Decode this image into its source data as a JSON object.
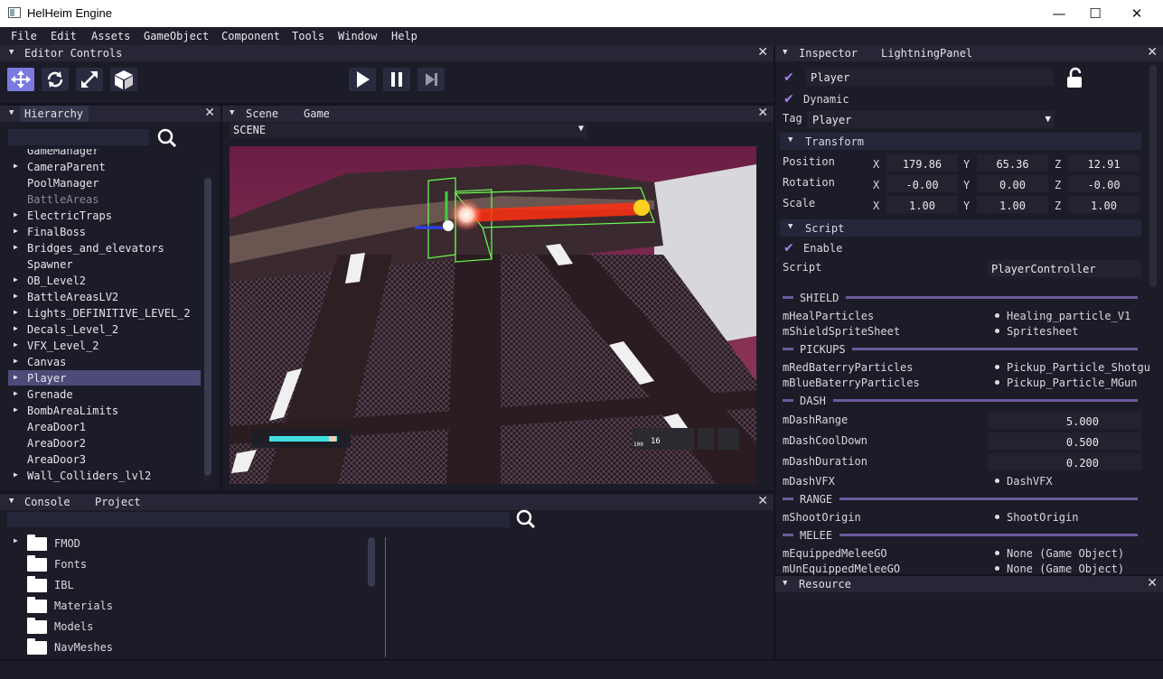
{
  "window": {
    "title": "HelHeim Engine",
    "minimize": "—",
    "maximize": "☐",
    "close": "✕"
  },
  "menu": [
    "File",
    "Edit",
    "Assets",
    "GameObject",
    "Component",
    "Tools",
    "Window",
    "Help"
  ],
  "editor_controls": {
    "title": "Editor Controls",
    "close": "✕"
  },
  "hierarchy": {
    "title": "Hierarchy",
    "close": "✕",
    "items": [
      {
        "label": "GameManager",
        "arrow": "",
        "dim": false
      },
      {
        "label": "CameraParent",
        "arrow": "▶",
        "dim": false
      },
      {
        "label": "PoolManager",
        "arrow": "",
        "dim": false
      },
      {
        "label": "BattleAreas",
        "arrow": "",
        "dim": true
      },
      {
        "label": "ElectricTraps",
        "arrow": "▶",
        "dim": false
      },
      {
        "label": "FinalBoss",
        "arrow": "▶",
        "dim": false
      },
      {
        "label": "Bridges_and_elevators",
        "arrow": "▶",
        "dim": false
      },
      {
        "label": "Spawner",
        "arrow": "",
        "dim": false
      },
      {
        "label": "OB_Level2",
        "arrow": "▶",
        "dim": false
      },
      {
        "label": "BattleAreasLV2",
        "arrow": "▶",
        "dim": false
      },
      {
        "label": "Lights_DEFINITIVE_LEVEL_2",
        "arrow": "▶",
        "dim": false
      },
      {
        "label": "Decals_Level_2",
        "arrow": "▶",
        "dim": false
      },
      {
        "label": "VFX_Level_2",
        "arrow": "▶",
        "dim": false
      },
      {
        "label": "Canvas",
        "arrow": "▶",
        "dim": false
      },
      {
        "label": "Player",
        "arrow": "▶",
        "dim": false,
        "selected": true
      },
      {
        "label": "Grenade",
        "arrow": "▶",
        "dim": false
      },
      {
        "label": "BombAreaLimits",
        "arrow": "▶",
        "dim": false
      },
      {
        "label": "AreaDoor1",
        "arrow": "",
        "dim": false
      },
      {
        "label": "AreaDoor2",
        "arrow": "",
        "dim": false
      },
      {
        "label": "AreaDoor3",
        "arrow": "",
        "dim": false
      },
      {
        "label": "Wall_Colliders_lvl2",
        "arrow": "▶",
        "dim": false
      }
    ]
  },
  "scene": {
    "tabs": [
      "Scene",
      "Game"
    ],
    "dropdown": "SCENE",
    "close": "✕",
    "hud_ammo": "16",
    "hud_charge": "100"
  },
  "console": {
    "tabs": [
      "Console",
      "Project"
    ],
    "close": "✕",
    "folders": [
      {
        "label": "FMOD",
        "arrow": "▶"
      },
      {
        "label": "Fonts",
        "arrow": ""
      },
      {
        "label": "IBL",
        "arrow": ""
      },
      {
        "label": "Materials",
        "arrow": ""
      },
      {
        "label": "Models",
        "arrow": ""
      },
      {
        "label": "NavMeshes",
        "arrow": ""
      }
    ]
  },
  "inspector": {
    "tabs": [
      "Inspector",
      "LightningPanel"
    ],
    "close": "✕",
    "name": "Player",
    "dynamic": "Dynamic",
    "tag_label": "Tag",
    "tag_value": "Player",
    "transform": {
      "title": "Transform",
      "rows": [
        {
          "label": "Position",
          "x": "179.86",
          "y": "65.36",
          "z": "12.91"
        },
        {
          "label": "Rotation",
          "x": "-0.00",
          "y": "0.00",
          "z": "-0.00"
        },
        {
          "label": "Scale",
          "x": "1.00",
          "y": "1.00",
          "z": "1.00"
        }
      ],
      "axes": [
        "X",
        "Y",
        "Z"
      ]
    },
    "script": {
      "title": "Script",
      "enable": "Enable",
      "label": "Script",
      "value": "PlayerController"
    },
    "groups": [
      {
        "name": "SHIELD"
      },
      {
        "name": "PICKUPS"
      },
      {
        "name": "DASH"
      },
      {
        "name": "RANGE"
      },
      {
        "name": "MELEE"
      }
    ],
    "refs": {
      "mHealParticles": "Healing_particle_V1",
      "mShieldSpriteSheet": "Spritesheet",
      "mRedBaterryParticles": "Pickup_Particle_Shotgu",
      "mBlueBaterryParticles": "Pickup_Particle_MGun",
      "mDashVFX": "DashVFX",
      "mShootOrigin": "ShootOrigin",
      "mEquippedMeleeGO": "None (Game Object)",
      "mUnEquippedMeleeGO": "None (Game Object)"
    },
    "nums": {
      "mDashRange": "5.000",
      "mDashCoolDown": "0.500",
      "mDashDuration": "0.200"
    }
  },
  "resource": {
    "title": "Resource",
    "close": "✕"
  }
}
